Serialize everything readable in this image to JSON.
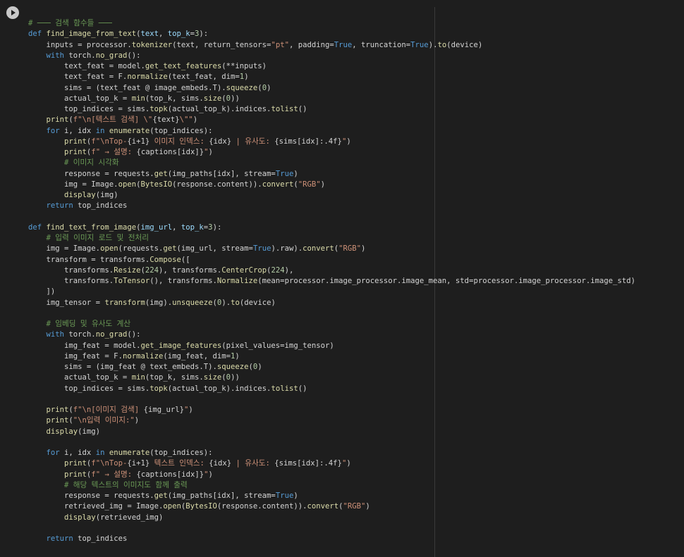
{
  "cell": {
    "run_icon": "play-icon",
    "code_lines": [
      [
        {
          "t": "# ─── 검색 함수들 ───",
          "c": "cm"
        }
      ],
      [
        {
          "t": "def ",
          "c": "kw"
        },
        {
          "t": "find_image_from_text",
          "c": "fn"
        },
        {
          "t": "(",
          "c": ""
        },
        {
          "t": "text",
          "c": "par"
        },
        {
          "t": ", ",
          "c": ""
        },
        {
          "t": "top_k",
          "c": "par"
        },
        {
          "t": "=",
          "c": ""
        },
        {
          "t": "3",
          "c": "num"
        },
        {
          "t": "):",
          "c": ""
        }
      ],
      [
        {
          "t": "    inputs = processor.",
          "c": ""
        },
        {
          "t": "tokenizer",
          "c": "fn"
        },
        {
          "t": "(text, return_tensors=",
          "c": ""
        },
        {
          "t": "\"pt\"",
          "c": "str"
        },
        {
          "t": ", padding=",
          "c": ""
        },
        {
          "t": "True",
          "c": "kwv"
        },
        {
          "t": ", truncation=",
          "c": ""
        },
        {
          "t": "True",
          "c": "kwv"
        },
        {
          "t": ").",
          "c": ""
        },
        {
          "t": "to",
          "c": "fn"
        },
        {
          "t": "(device)",
          "c": ""
        }
      ],
      [
        {
          "t": "    ",
          "c": ""
        },
        {
          "t": "with",
          "c": "kw"
        },
        {
          "t": " torch.",
          "c": ""
        },
        {
          "t": "no_grad",
          "c": "fn"
        },
        {
          "t": "():",
          "c": ""
        }
      ],
      [
        {
          "t": "        text_feat = model.",
          "c": ""
        },
        {
          "t": "get_text_features",
          "c": "fn"
        },
        {
          "t": "(**inputs)",
          "c": ""
        }
      ],
      [
        {
          "t": "        text_feat = F.",
          "c": ""
        },
        {
          "t": "normalize",
          "c": "fn"
        },
        {
          "t": "(text_feat, dim=",
          "c": ""
        },
        {
          "t": "1",
          "c": "num"
        },
        {
          "t": ")",
          "c": ""
        }
      ],
      [
        {
          "t": "        sims = (text_feat @ image_embeds.T).",
          "c": ""
        },
        {
          "t": "squeeze",
          "c": "fn"
        },
        {
          "t": "(",
          "c": ""
        },
        {
          "t": "0",
          "c": "num"
        },
        {
          "t": ")",
          "c": ""
        }
      ],
      [
        {
          "t": "        actual_top_k = ",
          "c": ""
        },
        {
          "t": "min",
          "c": "fn"
        },
        {
          "t": "(top_k, sims.",
          "c": ""
        },
        {
          "t": "size",
          "c": "fn"
        },
        {
          "t": "(",
          "c": ""
        },
        {
          "t": "0",
          "c": "num"
        },
        {
          "t": "))",
          "c": ""
        }
      ],
      [
        {
          "t": "        top_indices = sims.",
          "c": ""
        },
        {
          "t": "topk",
          "c": "fn"
        },
        {
          "t": "(actual_top_k).indices.",
          "c": ""
        },
        {
          "t": "tolist",
          "c": "fn"
        },
        {
          "t": "()",
          "c": ""
        }
      ],
      [
        {
          "t": "    ",
          "c": ""
        },
        {
          "t": "print",
          "c": "fn"
        },
        {
          "t": "(",
          "c": ""
        },
        {
          "t": "f\"\\n[텍스트 검색] \\\"",
          "c": "str"
        },
        {
          "t": "{text}",
          "c": ""
        },
        {
          "t": "\\\"\"",
          "c": "str"
        },
        {
          "t": ")",
          "c": ""
        }
      ],
      [
        {
          "t": "    ",
          "c": ""
        },
        {
          "t": "for",
          "c": "kw"
        },
        {
          "t": " i, idx ",
          "c": ""
        },
        {
          "t": "in",
          "c": "kw"
        },
        {
          "t": " ",
          "c": ""
        },
        {
          "t": "enumerate",
          "c": "fn"
        },
        {
          "t": "(top_indices):",
          "c": ""
        }
      ],
      [
        {
          "t": "        ",
          "c": ""
        },
        {
          "t": "print",
          "c": "fn"
        },
        {
          "t": "(",
          "c": ""
        },
        {
          "t": "f\"\\nTop-",
          "c": "str"
        },
        {
          "t": "{i+1}",
          "c": ""
        },
        {
          "t": " 이미지 인덱스: ",
          "c": "str"
        },
        {
          "t": "{idx}",
          "c": ""
        },
        {
          "t": " | 유사도: ",
          "c": "str"
        },
        {
          "t": "{sims[idx]:.4f}",
          "c": ""
        },
        {
          "t": "\"",
          "c": "str"
        },
        {
          "t": ")",
          "c": ""
        }
      ],
      [
        {
          "t": "        ",
          "c": ""
        },
        {
          "t": "print",
          "c": "fn"
        },
        {
          "t": "(",
          "c": ""
        },
        {
          "t": "f\" → 설명: ",
          "c": "str"
        },
        {
          "t": "{captions[idx]}",
          "c": ""
        },
        {
          "t": "\"",
          "c": "str"
        },
        {
          "t": ")",
          "c": ""
        }
      ],
      [
        {
          "t": "        # 이미지 시각화",
          "c": "cm"
        }
      ],
      [
        {
          "t": "        response = requests.",
          "c": ""
        },
        {
          "t": "get",
          "c": "fn"
        },
        {
          "t": "(img_paths[idx], stream=",
          "c": ""
        },
        {
          "t": "True",
          "c": "kwv"
        },
        {
          "t": ")",
          "c": ""
        }
      ],
      [
        {
          "t": "        img = Image.",
          "c": ""
        },
        {
          "t": "open",
          "c": "fn"
        },
        {
          "t": "(",
          "c": ""
        },
        {
          "t": "BytesIO",
          "c": "fn"
        },
        {
          "t": "(response.content)).",
          "c": ""
        },
        {
          "t": "convert",
          "c": "fn"
        },
        {
          "t": "(",
          "c": ""
        },
        {
          "t": "\"RGB\"",
          "c": "str"
        },
        {
          "t": ")",
          "c": ""
        }
      ],
      [
        {
          "t": "        ",
          "c": ""
        },
        {
          "t": "display",
          "c": "fn"
        },
        {
          "t": "(img)",
          "c": ""
        }
      ],
      [
        {
          "t": "    ",
          "c": ""
        },
        {
          "t": "return",
          "c": "kw"
        },
        {
          "t": " top_indices",
          "c": ""
        }
      ],
      [
        {
          "t": "",
          "c": ""
        }
      ],
      [
        {
          "t": "def ",
          "c": "kw"
        },
        {
          "t": "find_text_from_image",
          "c": "fn"
        },
        {
          "t": "(",
          "c": ""
        },
        {
          "t": "img_url",
          "c": "par"
        },
        {
          "t": ", ",
          "c": ""
        },
        {
          "t": "top_k",
          "c": "par"
        },
        {
          "t": "=",
          "c": ""
        },
        {
          "t": "3",
          "c": "num"
        },
        {
          "t": "):",
          "c": ""
        }
      ],
      [
        {
          "t": "    # 입력 이미지 로드 및 전처리",
          "c": "cm"
        }
      ],
      [
        {
          "t": "    img = Image.",
          "c": ""
        },
        {
          "t": "open",
          "c": "fn"
        },
        {
          "t": "(requests.",
          "c": ""
        },
        {
          "t": "get",
          "c": "fn"
        },
        {
          "t": "(img_url, stream=",
          "c": ""
        },
        {
          "t": "True",
          "c": "kwv"
        },
        {
          "t": ").raw).",
          "c": ""
        },
        {
          "t": "convert",
          "c": "fn"
        },
        {
          "t": "(",
          "c": ""
        },
        {
          "t": "\"RGB\"",
          "c": "str"
        },
        {
          "t": ")",
          "c": ""
        }
      ],
      [
        {
          "t": "    transform = transforms.",
          "c": ""
        },
        {
          "t": "Compose",
          "c": "fn"
        },
        {
          "t": "([",
          "c": ""
        }
      ],
      [
        {
          "t": "        transforms.",
          "c": ""
        },
        {
          "t": "Resize",
          "c": "fn"
        },
        {
          "t": "(",
          "c": ""
        },
        {
          "t": "224",
          "c": "num"
        },
        {
          "t": "), transforms.",
          "c": ""
        },
        {
          "t": "CenterCrop",
          "c": "fn"
        },
        {
          "t": "(",
          "c": ""
        },
        {
          "t": "224",
          "c": "num"
        },
        {
          "t": "),",
          "c": ""
        }
      ],
      [
        {
          "t": "        transforms.",
          "c": ""
        },
        {
          "t": "ToTensor",
          "c": "fn"
        },
        {
          "t": "(), transforms.",
          "c": ""
        },
        {
          "t": "Normalize",
          "c": "fn"
        },
        {
          "t": "(mean=processor.image_processor.image_mean, std=processor.image_processor.image_std)",
          "c": ""
        }
      ],
      [
        {
          "t": "    ])",
          "c": ""
        }
      ],
      [
        {
          "t": "    img_tensor = ",
          "c": ""
        },
        {
          "t": "transform",
          "c": "fn"
        },
        {
          "t": "(img).",
          "c": ""
        },
        {
          "t": "unsqueeze",
          "c": "fn"
        },
        {
          "t": "(",
          "c": ""
        },
        {
          "t": "0",
          "c": "num"
        },
        {
          "t": ").",
          "c": ""
        },
        {
          "t": "to",
          "c": "fn"
        },
        {
          "t": "(device)",
          "c": ""
        }
      ],
      [
        {
          "t": "",
          "c": ""
        }
      ],
      [
        {
          "t": "    # 임베딩 및 유사도 계산",
          "c": "cm"
        }
      ],
      [
        {
          "t": "    ",
          "c": ""
        },
        {
          "t": "with",
          "c": "kw"
        },
        {
          "t": " torch.",
          "c": ""
        },
        {
          "t": "no_grad",
          "c": "fn"
        },
        {
          "t": "():",
          "c": ""
        }
      ],
      [
        {
          "t": "        img_feat = model.",
          "c": ""
        },
        {
          "t": "get_image_features",
          "c": "fn"
        },
        {
          "t": "(pixel_values=img_tensor)",
          "c": ""
        }
      ],
      [
        {
          "t": "        img_feat = F.",
          "c": ""
        },
        {
          "t": "normalize",
          "c": "fn"
        },
        {
          "t": "(img_feat, dim=",
          "c": ""
        },
        {
          "t": "1",
          "c": "num"
        },
        {
          "t": ")",
          "c": ""
        }
      ],
      [
        {
          "t": "        sims = (img_feat @ text_embeds.T).",
          "c": ""
        },
        {
          "t": "squeeze",
          "c": "fn"
        },
        {
          "t": "(",
          "c": ""
        },
        {
          "t": "0",
          "c": "num"
        },
        {
          "t": ")",
          "c": ""
        }
      ],
      [
        {
          "t": "        actual_top_k = ",
          "c": ""
        },
        {
          "t": "min",
          "c": "fn"
        },
        {
          "t": "(top_k, sims.",
          "c": ""
        },
        {
          "t": "size",
          "c": "fn"
        },
        {
          "t": "(",
          "c": ""
        },
        {
          "t": "0",
          "c": "num"
        },
        {
          "t": "))",
          "c": ""
        }
      ],
      [
        {
          "t": "        top_indices = sims.",
          "c": ""
        },
        {
          "t": "topk",
          "c": "fn"
        },
        {
          "t": "(actual_top_k).indices.",
          "c": ""
        },
        {
          "t": "tolist",
          "c": "fn"
        },
        {
          "t": "()",
          "c": ""
        }
      ],
      [
        {
          "t": "",
          "c": ""
        }
      ],
      [
        {
          "t": "    ",
          "c": ""
        },
        {
          "t": "print",
          "c": "fn"
        },
        {
          "t": "(",
          "c": ""
        },
        {
          "t": "f\"\\n[이미지 검색] ",
          "c": "str"
        },
        {
          "t": "{img_url}",
          "c": ""
        },
        {
          "t": "\"",
          "c": "str"
        },
        {
          "t": ")",
          "c": ""
        }
      ],
      [
        {
          "t": "    ",
          "c": ""
        },
        {
          "t": "print",
          "c": "fn"
        },
        {
          "t": "(",
          "c": ""
        },
        {
          "t": "\"\\n입력 이미지:\"",
          "c": "str"
        },
        {
          "t": ")",
          "c": ""
        }
      ],
      [
        {
          "t": "    ",
          "c": ""
        },
        {
          "t": "display",
          "c": "fn"
        },
        {
          "t": "(img)",
          "c": ""
        }
      ],
      [
        {
          "t": "",
          "c": ""
        }
      ],
      [
        {
          "t": "    ",
          "c": ""
        },
        {
          "t": "for",
          "c": "kw"
        },
        {
          "t": " i, idx ",
          "c": ""
        },
        {
          "t": "in",
          "c": "kw"
        },
        {
          "t": " ",
          "c": ""
        },
        {
          "t": "enumerate",
          "c": "fn"
        },
        {
          "t": "(top_indices):",
          "c": ""
        }
      ],
      [
        {
          "t": "        ",
          "c": ""
        },
        {
          "t": "print",
          "c": "fn"
        },
        {
          "t": "(",
          "c": ""
        },
        {
          "t": "f\"\\nTop-",
          "c": "str"
        },
        {
          "t": "{i+1}",
          "c": ""
        },
        {
          "t": " 텍스트 인덱스: ",
          "c": "str"
        },
        {
          "t": "{idx}",
          "c": ""
        },
        {
          "t": " | 유사도: ",
          "c": "str"
        },
        {
          "t": "{sims[idx]:.4f}",
          "c": ""
        },
        {
          "t": "\"",
          "c": "str"
        },
        {
          "t": ")",
          "c": ""
        }
      ],
      [
        {
          "t": "        ",
          "c": ""
        },
        {
          "t": "print",
          "c": "fn"
        },
        {
          "t": "(",
          "c": ""
        },
        {
          "t": "f\" → 설명: ",
          "c": "str"
        },
        {
          "t": "{captions[idx]}",
          "c": ""
        },
        {
          "t": "\"",
          "c": "str"
        },
        {
          "t": ")",
          "c": ""
        }
      ],
      [
        {
          "t": "        # 해당 텍스트의 이미지도 함께 출력",
          "c": "cm"
        }
      ],
      [
        {
          "t": "        response = requests.",
          "c": ""
        },
        {
          "t": "get",
          "c": "fn"
        },
        {
          "t": "(img_paths[idx], stream=",
          "c": ""
        },
        {
          "t": "True",
          "c": "kwv"
        },
        {
          "t": ")",
          "c": ""
        }
      ],
      [
        {
          "t": "        retrieved_img = Image.",
          "c": ""
        },
        {
          "t": "open",
          "c": "fn"
        },
        {
          "t": "(",
          "c": ""
        },
        {
          "t": "BytesIO",
          "c": "fn"
        },
        {
          "t": "(response.content)).",
          "c": ""
        },
        {
          "t": "convert",
          "c": "fn"
        },
        {
          "t": "(",
          "c": ""
        },
        {
          "t": "\"RGB\"",
          "c": "str"
        },
        {
          "t": ")",
          "c": ""
        }
      ],
      [
        {
          "t": "        ",
          "c": ""
        },
        {
          "t": "display",
          "c": "fn"
        },
        {
          "t": "(retrieved_img)",
          "c": ""
        }
      ],
      [
        {
          "t": "",
          "c": ""
        }
      ],
      [
        {
          "t": "    ",
          "c": ""
        },
        {
          "t": "return",
          "c": "kw"
        },
        {
          "t": " top_indices",
          "c": ""
        }
      ]
    ]
  }
}
